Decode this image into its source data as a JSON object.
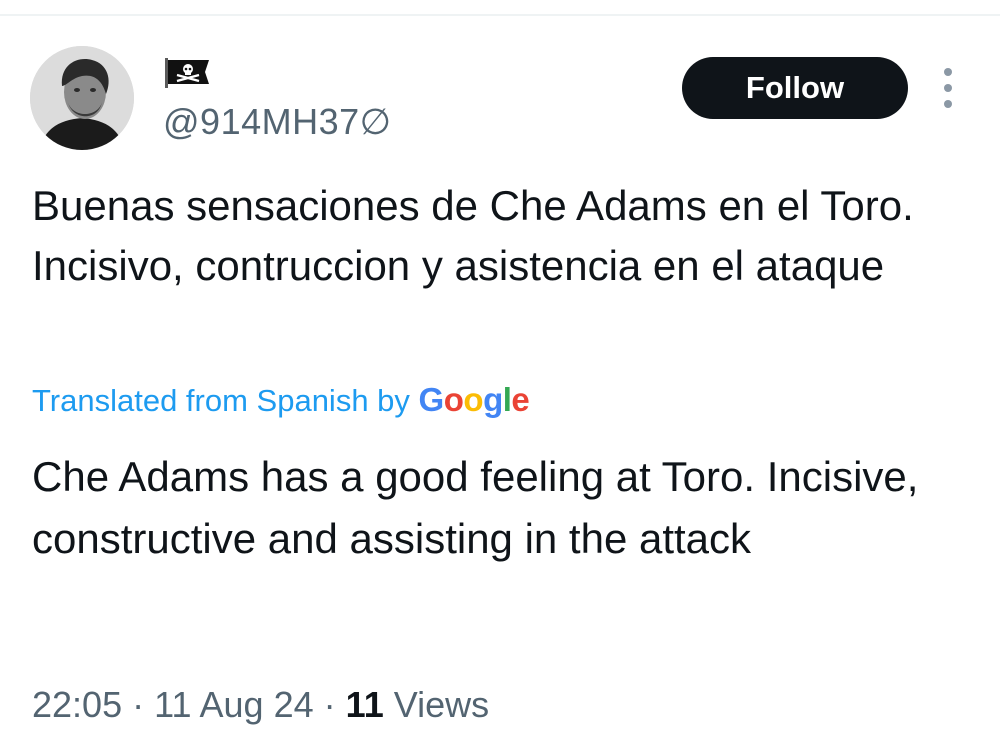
{
  "author": {
    "flag_icon": "pirate-flag-icon",
    "handle": "@914MH37∅",
    "avatar_icon": "profile-photo"
  },
  "follow_label": "Follow",
  "more_icon": "vertical-ellipsis-icon",
  "post": {
    "text": "Buenas sensaciones de Che Adams en el Toro. Incisivo, contruccion y asistencia en el ataque"
  },
  "translation": {
    "label": "Translated from Spanish by",
    "provider": {
      "g1": "G",
      "o1": "o",
      "o2": "o",
      "g2": "g",
      "l": "l",
      "e": "e"
    },
    "text": "Che Adams has a good feeling at Toro. Incisive, constructive and assisting in the attack"
  },
  "meta": {
    "time": "22:05",
    "separator": "·",
    "date": "11 Aug 24",
    "views_count": "11",
    "views_label": "Views"
  },
  "colors": {
    "accent": "#1d9bf0",
    "text_primary": "#0f1419",
    "text_secondary": "#536471",
    "button_bg": "#0f1419"
  }
}
